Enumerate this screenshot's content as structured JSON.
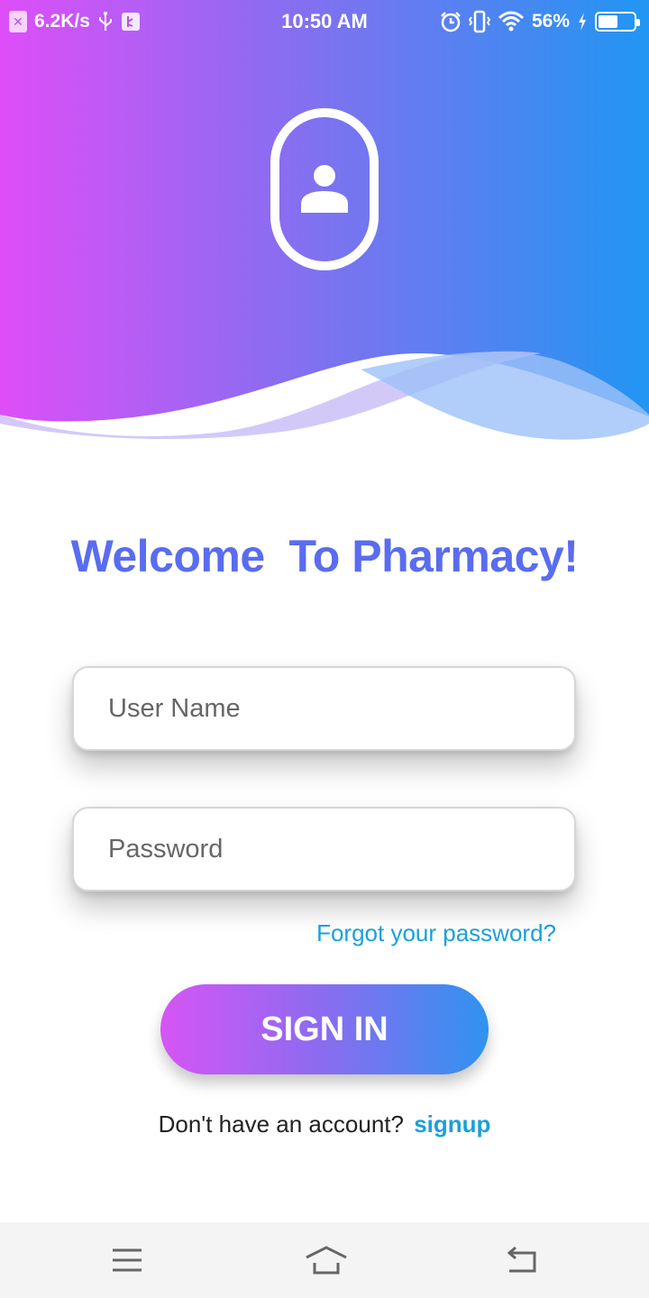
{
  "status_bar": {
    "net_speed": "6.2K/s",
    "time": "10:50 AM",
    "battery_percent": "56%",
    "battery_level": 0.56,
    "icons": [
      "sim-off-icon",
      "usb-icon",
      "usb-debug-icon",
      "alarm-icon",
      "vibrate-icon",
      "wifi-icon",
      "charging-icon",
      "battery-icon"
    ]
  },
  "hero": {
    "gradient_colors": [
      "#de4ef8",
      "#7d72f0",
      "#2196f3"
    ],
    "logo_icon": "user-icon"
  },
  "welcome": {
    "title": "Welcome  To Pharmacy!",
    "color": "#5a6cf0"
  },
  "form": {
    "username_placeholder": "User Name",
    "username_value": "",
    "password_placeholder": "Password",
    "password_value": "",
    "forgot_label": "Forgot your password?",
    "signin_label": "SIGN IN",
    "signup_prompt": "Don't have an account?",
    "signup_label": "signup",
    "link_color": "#1aa0dc"
  },
  "nav_bar": {
    "icons": [
      "menu-icon",
      "home-icon",
      "back-icon"
    ]
  }
}
